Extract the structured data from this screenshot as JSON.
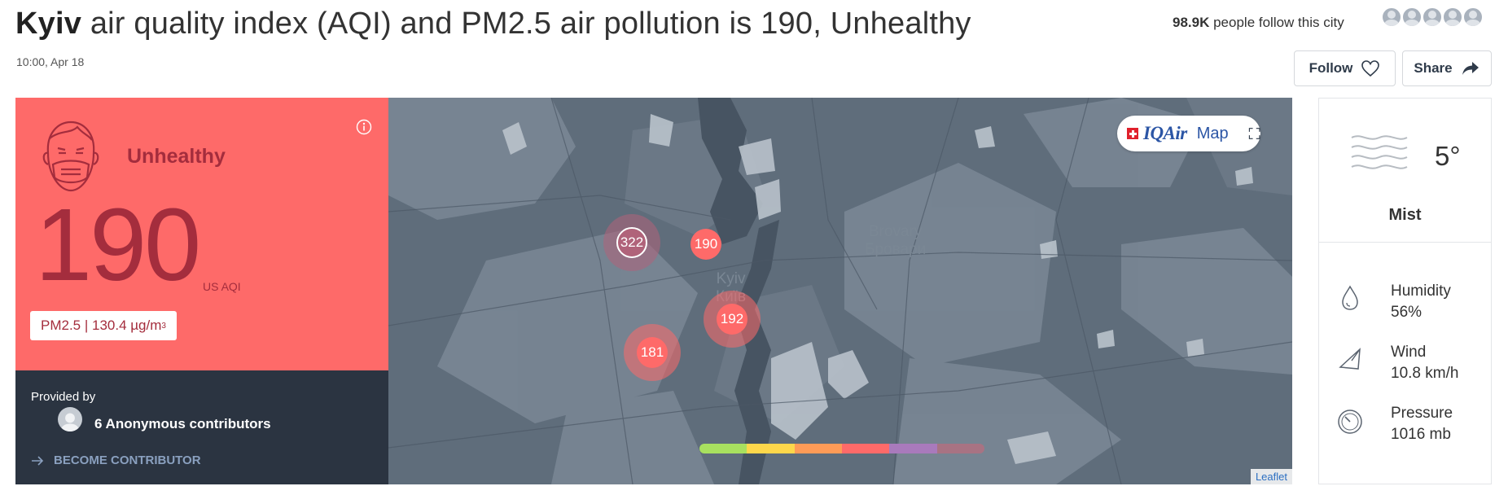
{
  "header": {
    "city": "Kyiv",
    "title_rest": " air quality index (AQI) and PM2.5 air pollution is 190, Unhealthy",
    "timestamp": "10:00, Apr 18",
    "followers_count": "98.9K",
    "followers_text": " people follow this city",
    "follow_label": "Follow",
    "share_label": "Share"
  },
  "aqi": {
    "status": "Unhealthy",
    "value": "190",
    "unit": "US AQI",
    "pm_label": "PM2.5 | 130.4 µg/m",
    "pm_sup": "3",
    "panel_color": "#fe6a69",
    "text_color": "#a42d3d"
  },
  "contributors": {
    "provided_by": "Provided by",
    "name": "6 Anonymous contributors",
    "become": "BECOME CONTRIBUTOR"
  },
  "map": {
    "brand": "IQAir",
    "brand_suffix": "Map",
    "labels": {
      "brovary_en": "Brovary",
      "brovary_uk": "Бровари",
      "kyiv_en": "Kyiv",
      "kyiv_uk": "Київ"
    },
    "markers": [
      {
        "value": "322",
        "color": "#b0637a"
      },
      {
        "value": "190",
        "color": "#fe6a69"
      },
      {
        "value": "192",
        "color": "#fe6a69"
      },
      {
        "value": "181",
        "color": "#fe6a69"
      }
    ],
    "scale_colors": [
      "#a8e05f",
      "#fdd74b",
      "#fe9b57",
      "#fe6a69",
      "#a97abc",
      "#a87383"
    ],
    "attribution": "Leaflet"
  },
  "weather": {
    "temperature": "5°",
    "condition": "Mist",
    "humidity_label": "Humidity",
    "humidity_value": "56%",
    "wind_label": "Wind",
    "wind_value": "10.8 km/h",
    "pressure_label": "Pressure",
    "pressure_value": "1016 mb"
  }
}
